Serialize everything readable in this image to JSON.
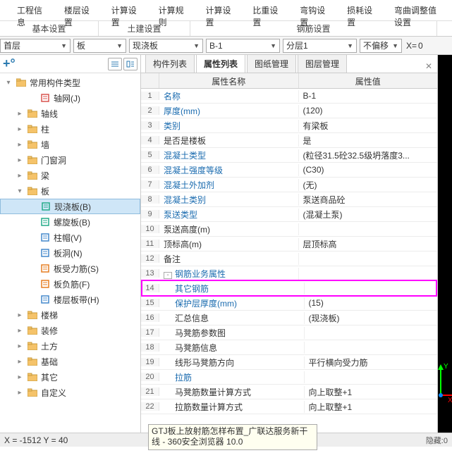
{
  "ribbon": {
    "tabs": [
      "工程信息",
      "楼层设置",
      "计算设置",
      "计算规则",
      "计算设置",
      "比重设置",
      "弯钩设置",
      "损耗设置",
      "弯曲调整值设置"
    ],
    "groups": [
      "基本设置",
      "土建设置",
      "钢筋设置"
    ]
  },
  "toolbar": {
    "floor": "首层",
    "category": "板",
    "type": "现浇板",
    "code": "B-1",
    "layer": "分层1",
    "offset": "不偏移",
    "x_label": "X=",
    "x_val": "0"
  },
  "tree": {
    "root": "常用构件类型",
    "items": [
      {
        "label": "轴网(J)",
        "lv": 1,
        "leaf": true,
        "iconColor": "#d9534f"
      },
      {
        "label": "轴线",
        "lv": 0
      },
      {
        "label": "柱",
        "lv": 0
      },
      {
        "label": "墙",
        "lv": 0
      },
      {
        "label": "门窗洞",
        "lv": 0
      },
      {
        "label": "梁",
        "lv": 0
      },
      {
        "label": "板",
        "lv": 0,
        "open": true
      },
      {
        "label": "现浇板(B)",
        "lv": 1,
        "leaf": true,
        "selected": true,
        "iconColor": "#2a8"
      },
      {
        "label": "螺旋板(B)",
        "lv": 1,
        "leaf": true,
        "iconColor": "#2a8"
      },
      {
        "label": "柱帽(V)",
        "lv": 1,
        "leaf": true,
        "iconColor": "#48c"
      },
      {
        "label": "板洞(N)",
        "lv": 1,
        "leaf": true,
        "iconColor": "#48c"
      },
      {
        "label": "板受力筋(S)",
        "lv": 1,
        "leaf": true,
        "iconColor": "#e67e22"
      },
      {
        "label": "板负筋(F)",
        "lv": 1,
        "leaf": true,
        "iconColor": "#e67e22"
      },
      {
        "label": "楼层板带(H)",
        "lv": 1,
        "leaf": true,
        "iconColor": "#48c"
      },
      {
        "label": "楼梯",
        "lv": 0
      },
      {
        "label": "装修",
        "lv": 0
      },
      {
        "label": "土方",
        "lv": 0
      },
      {
        "label": "基础",
        "lv": 0
      },
      {
        "label": "其它",
        "lv": 0
      },
      {
        "label": "自定义",
        "lv": 0
      }
    ]
  },
  "mid_tabs": [
    "构件列表",
    "属性列表",
    "图纸管理",
    "图层管理"
  ],
  "mid_active": 1,
  "grid": {
    "head_name": "属性名称",
    "head_value": "属性值",
    "rows": [
      {
        "n": "1",
        "name": "名称",
        "value": "B-1",
        "link": true
      },
      {
        "n": "2",
        "name": "厚度(mm)",
        "value": "(120)",
        "link": true
      },
      {
        "n": "3",
        "name": "类别",
        "value": "有梁板",
        "link": true
      },
      {
        "n": "4",
        "name": "是否是楼板",
        "value": "是"
      },
      {
        "n": "5",
        "name": "混凝土类型",
        "value": "(粒径31.5砼32.5级坍落度3...",
        "link": true
      },
      {
        "n": "6",
        "name": "混凝土强度等级",
        "value": "(C30)",
        "link": true
      },
      {
        "n": "7",
        "name": "混凝土外加剂",
        "value": "(无)",
        "link": true
      },
      {
        "n": "8",
        "name": "混凝土类别",
        "value": "泵送商品砼",
        "link": true
      },
      {
        "n": "9",
        "name": "泵送类型",
        "value": "(混凝土泵)",
        "link": true
      },
      {
        "n": "10",
        "name": "泵送高度(m)",
        "value": ""
      },
      {
        "n": "11",
        "name": "顶标高(m)",
        "value": "层顶标高"
      },
      {
        "n": "12",
        "name": "备注",
        "value": ""
      },
      {
        "n": "13",
        "name": "钢筋业务属性",
        "value": "",
        "group": true,
        "toggler": "-"
      },
      {
        "n": "14",
        "name": "其它钢筋",
        "value": "",
        "indent": true,
        "link": true,
        "highlight": true
      },
      {
        "n": "15",
        "name": "保护层厚度(mm)",
        "value": "(15)",
        "indent": true,
        "link": true
      },
      {
        "n": "16",
        "name": "汇总信息",
        "value": "(现浇板)",
        "indent": true
      },
      {
        "n": "17",
        "name": "马凳筋参数图",
        "value": "",
        "indent": true
      },
      {
        "n": "18",
        "name": "马凳筋信息",
        "value": "",
        "indent": true
      },
      {
        "n": "19",
        "name": "线形马凳筋方向",
        "value": "平行横向受力筋",
        "indent": true
      },
      {
        "n": "20",
        "name": "拉筋",
        "value": "",
        "indent": true,
        "link": true
      },
      {
        "n": "21",
        "name": "马凳筋数量计算方式",
        "value": "向上取整+1",
        "indent": true
      },
      {
        "n": "22",
        "name": "拉筋数量计算方式",
        "value": "向上取整+1",
        "indent": true
      }
    ]
  },
  "status": {
    "coords": "X = -1512 Y = 40",
    "hide": "隐藏:0"
  },
  "tooltip": "GTJ板上放射筋怎样布置_广联达服务新干线 - 360安全浏览器 10.0",
  "axis_labels": {
    "x": "X",
    "y": "Y"
  }
}
